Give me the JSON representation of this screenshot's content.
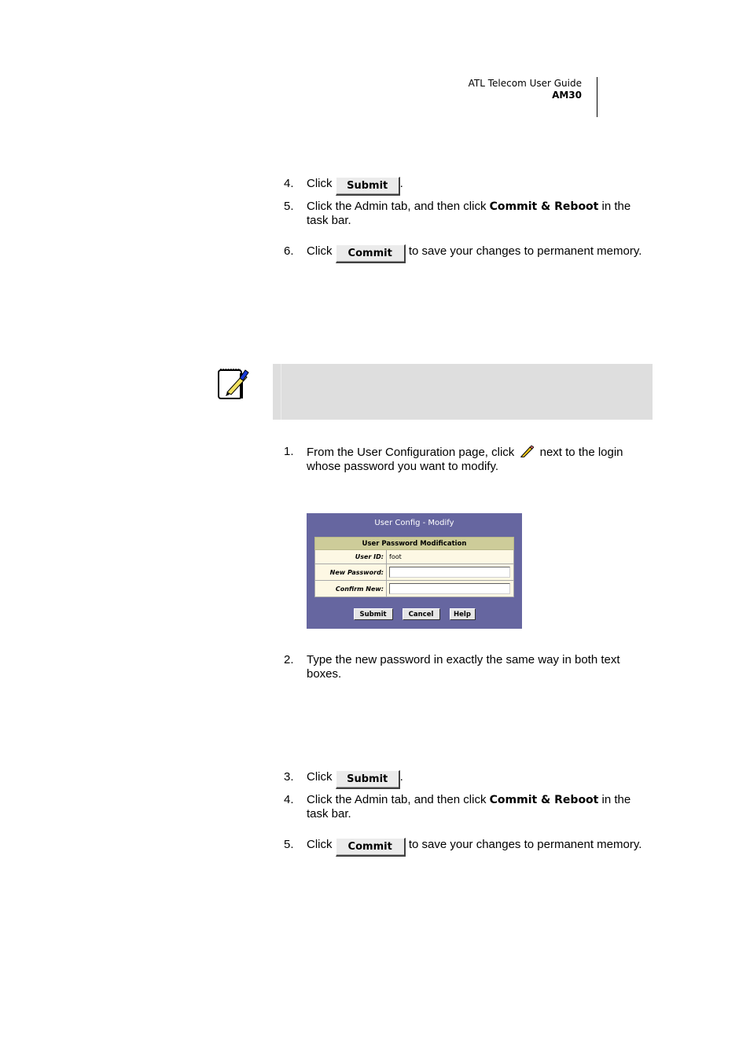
{
  "header": {
    "guide_title": "ATL Telecom User Guide",
    "model": "AM30"
  },
  "section1": {
    "steps": [
      {
        "num": "4.",
        "pre": "Click ",
        "button": "Submit",
        "post": "."
      },
      {
        "num": "5.",
        "pre": "Click the Admin tab, and then click ",
        "bold": "Commit & Reboot",
        "post": " in the task bar."
      },
      {
        "num": "6.",
        "pre": "Click ",
        "button": "Commit",
        "post": " to save your changes to permanent memory."
      }
    ]
  },
  "note": {
    "icon": "note-pad-pen-icon",
    "text": ""
  },
  "section2": {
    "step1": {
      "num": "1.",
      "pre": "From the User Configuration page, click ",
      "icon": "pencil-edit-icon",
      "post": " next to the login whose password you want to modify."
    },
    "step2": {
      "num": "2.",
      "text": "Type the new password in exactly the same way in both text boxes."
    },
    "step3": {
      "num": "3.",
      "pre": "Click ",
      "button": "Submit",
      "post": "."
    },
    "step4": {
      "num": "4.",
      "pre": "Click the Admin tab, and then click ",
      "bold": "Commit & Reboot",
      "post": " in the task bar."
    },
    "step5": {
      "num": "5.",
      "pre": "Click ",
      "button": "Commit",
      "post": " to save your changes to permanent memory."
    }
  },
  "dialog": {
    "title": "User Config - Modify",
    "table_header": "User Password Modification",
    "rows": [
      {
        "label": "User ID:",
        "value": "foot"
      },
      {
        "label": "New Password:",
        "value": ""
      },
      {
        "label": "Confirm New:",
        "value": ""
      }
    ],
    "buttons": {
      "submit": "Submit",
      "cancel": "Cancel",
      "help": "Help"
    },
    "colors": {
      "background": "#6666a0",
      "header_row": "#cdcc99",
      "table_bg": "#fdf8e4"
    }
  }
}
